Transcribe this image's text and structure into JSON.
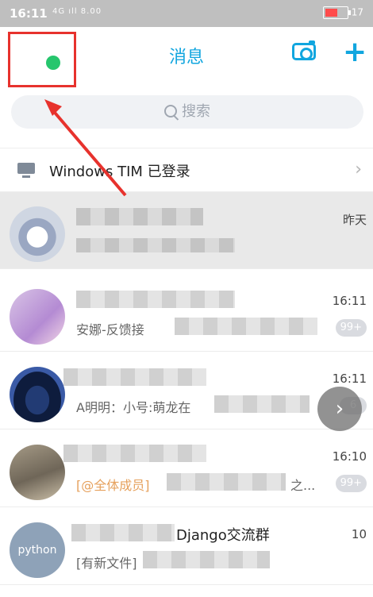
{
  "status_bar": {
    "time": "16:11",
    "signal": "4G ıll 8.00",
    "battery": "17"
  },
  "header": {
    "title": "消息"
  },
  "search": {
    "placeholder": "搜索"
  },
  "tim_row": {
    "label": "Windows TIM 已登录"
  },
  "conversations": [
    {
      "time": "昨天",
      "message": "",
      "badge": ""
    },
    {
      "time": "16:11",
      "message": "安娜-反馈接",
      "badge": "99+"
    },
    {
      "time": "16:11",
      "message": "A明明：小号:萌龙在",
      "badge": "6"
    },
    {
      "time": "16:10",
      "message": "[@全体成员]",
      "message_tail": "之...",
      "badge": "99+"
    },
    {
      "time": "10",
      "name": "Django交流群",
      "message": "[有新文件]",
      "badge": "",
      "avatar_text": "python"
    }
  ],
  "colors": {
    "accent": "#11a6df",
    "highlight_box": "#e7322d",
    "online_dot": "#26c66d",
    "badge": "#d9dbe0"
  }
}
